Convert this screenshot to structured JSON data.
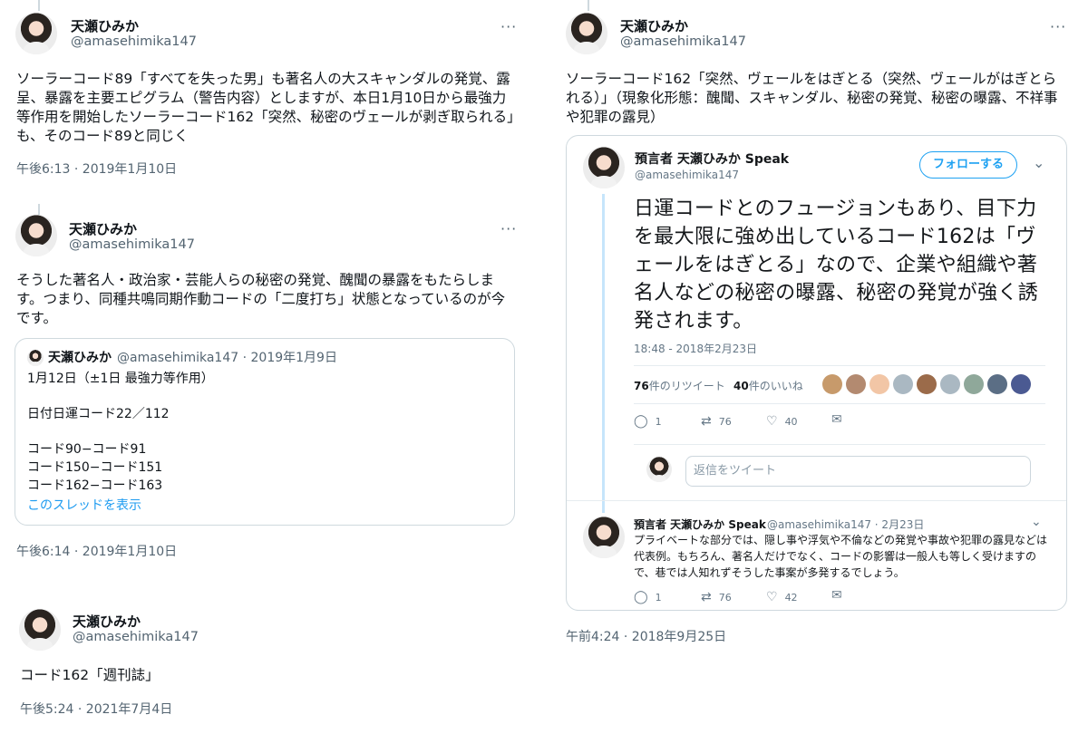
{
  "tweets": [
    {
      "name": "天瀬ひみか",
      "handle": "@amasehimika147",
      "more": "···",
      "text": "ソーラーコード89「すべてを失った男」も著名人の大スキャンダルの発覚、露呈、暴露を主要エピグラム（警告内容）としますが、本日1月10日から最強力等作用を開始したソーラーコード162「突然、秘密のヴェールが剥ぎ取られる」も、そのコード89と同じく",
      "timestamp": "午後6:13 · 2019年1月10日"
    },
    {
      "name": "天瀬ひみか",
      "handle": "@amasehimika147",
      "more": "···",
      "text": "そうした著名人・政治家・芸能人らの秘密の発覚、醜聞の暴露をもたらします。つまり、同種共鳴同期作動コードの「二度打ち」状態となっているのが今です。",
      "timestamp": "午後6:14 · 2019年1月10日",
      "quote": {
        "name": "天瀬ひみか",
        "meta": "@amasehimika147 · 2019年1月9日",
        "lines": [
          "1月12日（±1日 最強力等作用）",
          "",
          "日付日運コード22／112",
          "",
          "コード90−コード91",
          "コード150−コード151",
          "コード162−コード163"
        ],
        "link": "このスレッドを表示"
      }
    },
    {
      "name": "天瀬ひみか",
      "handle": "@amasehimika147",
      "text": "コード162「週刊誌」",
      "timestamp": "午後5:24 · 2021年7月4日"
    },
    {
      "name": "天瀬ひみか",
      "handle": "@amasehimika147",
      "more": "···",
      "text": "ソーラーコード162「突然、ヴェールをはぎとる（突然、ヴェールがはぎとられる）」（現象化形態：醜聞、スキャンダル、秘密の発覚、秘密の曝露、不祥事や犯罪の露見）",
      "timestamp": "午前4:24 · 2018年9月25日"
    }
  ],
  "embed": {
    "name": "預言者 天瀬ひみか Speak",
    "handle": "@amasehimika147",
    "follow_label": "フォローする",
    "chevron": "⌄",
    "text": "日運コードとのフュージョンもあり、目下力を最大限に強め出しているコード162は「ヴェールをはぎとる」なので、企業や組織や著名人などの秘密の曝露、秘密の発覚が強く誘発されます。",
    "timestamp": "18:48 - 2018年2月23日",
    "retweets_num": "76",
    "retweets_label": "件のリツイート",
    "likes_num": "40",
    "likes_label": "件のいいね",
    "actions": {
      "reply": "1",
      "retweet": "76",
      "like": "40"
    },
    "reply_placeholder": "返信をツイート",
    "reply": {
      "name": "預言者 天瀬ひみか Speak",
      "meta": "@amasehimika147 · 2月23日",
      "text": "プライベートな部分では、隠し事や浮気や不倫などの発覚や事故や犯罪の露見などは代表例。もちろん、著名人だけでなく、コードの影響は一般人も等しく受けますので、巷では人知れずそうした事案が多発するでしょう。",
      "actions": {
        "reply": "1",
        "retweet": "76",
        "like": "42"
      }
    }
  },
  "colors": {
    "text": "#0f1419",
    "secondary": "#536471",
    "link": "#1d9bf0",
    "border": "#cfd9de"
  }
}
